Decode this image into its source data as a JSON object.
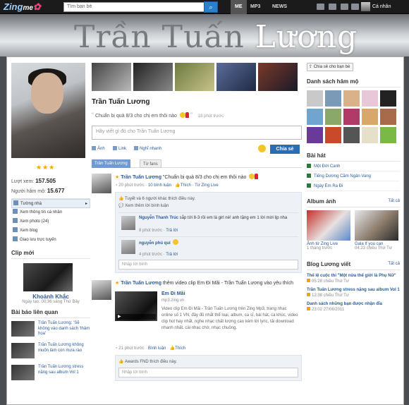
{
  "topbar": {
    "logo": "Zing",
    "logo_me": "me",
    "search_placeholder": "Tìm bạn bè",
    "nav": [
      "ME",
      "MP3",
      "NEWS"
    ],
    "user_menu": "Cá nhân"
  },
  "banner": {
    "title_main": "Trần Tuấn ",
    "title_highlight": "Lương"
  },
  "profile": {
    "name": "Trần Tuấn Lương",
    "stars": "★★★",
    "views_label": "Lượt xem:",
    "views": "157.505",
    "fans_label": "Người hâm mộ:",
    "fans": "15.677"
  },
  "left_menu": [
    "Tường nhà",
    "Xem thông tin cá nhân",
    "Xem photo (24)",
    "Xem blog",
    "Giao lưu trực tuyến"
  ],
  "clip": {
    "section": "Clip mới",
    "title": "Khoảnh Khắc",
    "meta": "Ngày tạo: 00:36 sáng Thứ Bảy"
  },
  "related": {
    "section": "Bài báo liên quan",
    "items": [
      "Trần Tuấn Lương: 'Sẽ không vào danh sách 'thảm họa'",
      "Trần Tuấn Lương không muốn làm con mưa rào",
      "Trần Tuấn Lương stress nặng sau album Vol 1"
    ]
  },
  "status": {
    "text": "Chuẩn bị quà 8/3 cho chị em thôi nào",
    "time": "18 phút trước"
  },
  "composer": {
    "placeholder": "Hãy viết gì đó cho Trần Tuấn Lương",
    "tool_photo": "Ảnh",
    "tool_link": "Link",
    "tool_thought": "Nghĩ nhanh",
    "share": "Chia sẻ"
  },
  "tabs": [
    "Trần Tuấn Lương",
    "Từ fans"
  ],
  "post1": {
    "author": "Trần Tuấn Lương",
    "text": " \"Chuẩn bị quà 8/3 cho chị em thôi nào",
    "time": "20 phút trước",
    "comments": "10 bình luận",
    "like": "Thích",
    "source": "Từ Zing Live",
    "likes_row": "Tuyết và 6 người khác thích điều này.",
    "more": "Xem thêm lời bình luận",
    "c1_author": "Nguyễn Thanh Trúc",
    "c1_text": " sắp tới 8-3 rồi em là girl nè! anh tặng em 1 lời mời lịp nha",
    "c1_time": "8 phút trước",
    "c2_author": "nguyễn phú quí",
    "c2_time": "4 phút trước",
    "reply": "Trả lời",
    "reply_placeholder": "Nhập lời bình"
  },
  "post2": {
    "author": "Trần Tuấn Lương",
    "text": " thêm video clip Em Đi Mãi - Trần Tuấn Lương vào yêu thích",
    "video_title": "Em Đi Mãi",
    "video_src": "mp3.zing.vn",
    "video_desc": "Video clip Em Đi Mãi - Trần Tuấn Lương trên Zing Mp3, trang nhạc online số 1 VN, đầy đủ nhất thể loại, album, ca sĩ, bài hát, ca khúc, video clip hot hay nhất, nghe nhạc chất lượng cao kèm lời lyric, tải download nhanh nhất, cài nhạc chờ, nhạc chuông.",
    "play": "▶",
    "time": "21 phút trước",
    "comment": "Bình luận",
    "like": "Thích",
    "likes_row": "Awards FND thích điều này.",
    "reply_placeholder": "Nhập lời bình"
  },
  "right": {
    "share": "Chia sẻ cho bạn bè",
    "fans_title": "Danh sách hâm mộ",
    "songs_title": "Bài hát",
    "songs": [
      "Một Đời Canh",
      "Tiếng Dương Cầm Ngân Vang",
      "Ngày Em Ra Đi"
    ],
    "albums_title": "Album ảnh",
    "all": "Tất cả",
    "albums": [
      {
        "title": "Ảnh từ Zing Live",
        "meta": "1 tháng trước"
      },
      {
        "title": "Gala If you can",
        "meta": "04:23 chiều Thứ Tư"
      }
    ],
    "blog_title": "Blog Lương viết",
    "blogs": [
      {
        "title": "Thế lệ cuộc thi \"Một nửa thế giới là Phụ Nữ\"",
        "meta": "05:28 chiều Thứ Tư"
      },
      {
        "title": "Trần Tuấn Lương stress nặng sau album Vol 1",
        "meta": "12:38 chiều Thứ Tư"
      },
      {
        "title": "Danh sách những bạn được nhận đĩa",
        "meta": "23:02 27/06/2011"
      }
    ]
  },
  "colors": {
    "accent": "#2b6cb4",
    "link": "#2a5b9a",
    "topbar": "#1b1b1b",
    "star": "#f5a400"
  }
}
